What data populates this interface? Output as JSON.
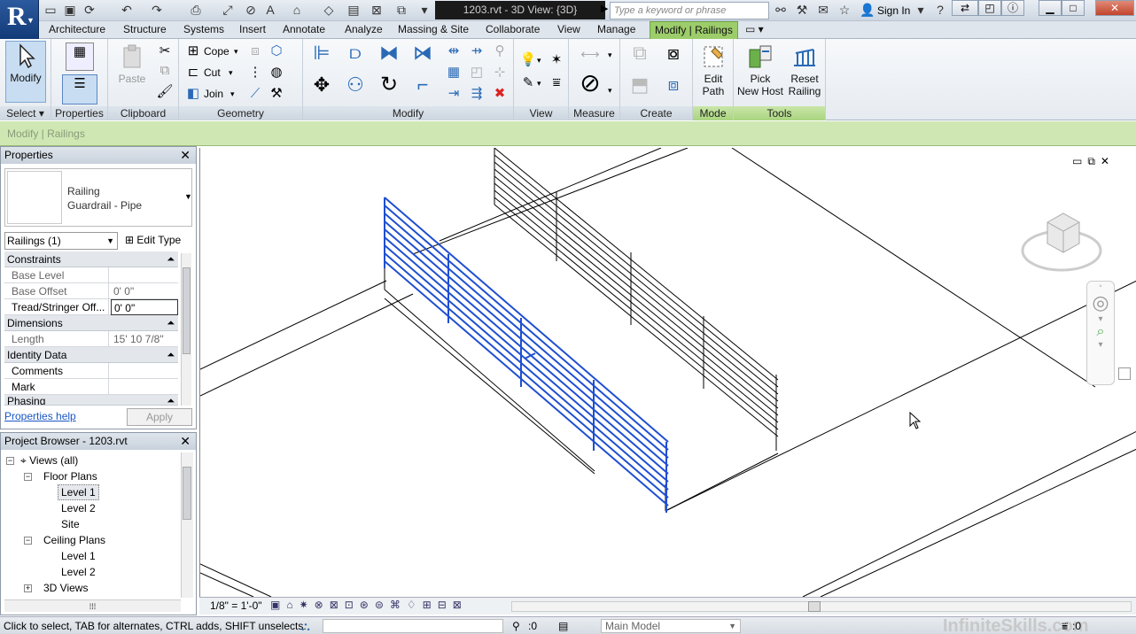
{
  "title_bar": {
    "doc_title": "1203.rvt - 3D View: {3D}",
    "search_placeholder": "Type a keyword or phrase",
    "sign_in": "Sign In"
  },
  "tabs": [
    "Architecture",
    "Structure",
    "Systems",
    "Insert",
    "Annotate",
    "Analyze",
    "Massing & Site",
    "Collaborate",
    "View",
    "Manage",
    "Modify | Railings"
  ],
  "ribbon": {
    "modify_label": "Modify",
    "paste_label": "Paste",
    "cope": "Cope",
    "cut": "Cut",
    "join": "Join",
    "edit_path": [
      "Edit",
      "Path"
    ],
    "pick_new_host": [
      "Pick",
      "New Host"
    ],
    "reset_railing": [
      "Reset",
      "Railing"
    ],
    "panels": {
      "select": "Select",
      "properties": "Properties",
      "clipboard": "Clipboard",
      "geometry": "Geometry",
      "modify": "Modify",
      "view": "View",
      "measure": "Measure",
      "create": "Create",
      "mode": "Mode",
      "tools": "Tools"
    }
  },
  "options_bar": "Modify | Railings",
  "properties": {
    "title": "Properties",
    "family": "Railing",
    "type": "Guardrail - Pipe",
    "selector": "Railings (1)",
    "edit_type": "Edit Type",
    "groups": {
      "constraints": "Constraints",
      "dimensions": "Dimensions",
      "identity": "Identity Data",
      "phasing": "Phasing"
    },
    "rows": {
      "base_level": {
        "k": "Base Level",
        "v": ""
      },
      "base_offset": {
        "k": "Base Offset",
        "v": "0'  0\""
      },
      "tread": {
        "k": "Tread/Stringer Off...",
        "v": "0'  0\""
      },
      "length": {
        "k": "Length",
        "v": "15'  10 7/8\""
      },
      "comments": {
        "k": "Comments",
        "v": ""
      },
      "mark": {
        "k": "Mark",
        "v": ""
      }
    },
    "help": "Properties help",
    "apply": "Apply"
  },
  "browser": {
    "title": "Project Browser - 1203.rvt",
    "views_all": "Views (all)",
    "floor_plans": "Floor Plans",
    "fp_level1": "Level 1",
    "fp_level2": "Level 2",
    "fp_site": "Site",
    "ceiling_plans": "Ceiling Plans",
    "cp_level1": "Level 1",
    "cp_level2": "Level 2",
    "views_3d": "3D Views"
  },
  "view_bar": {
    "scale": "1/8\" = 1'-0\""
  },
  "status": {
    "hint": "Click to select, TAB for alternates, CTRL adds, SHIFT unselects.",
    "count": ":0",
    "model": "Main Model",
    "watermark": "InfiniteSkills.com",
    "filter": ":0"
  },
  "colors": {
    "selected": "#1f4fd1",
    "context_tab": "#9ccd6a"
  }
}
